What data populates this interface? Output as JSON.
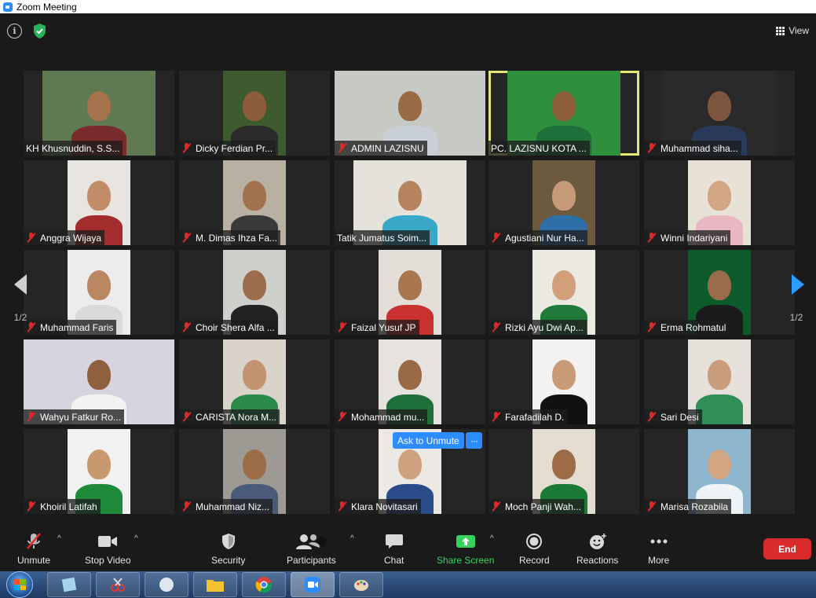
{
  "window": {
    "title": "Zoom Meeting"
  },
  "header": {
    "view_label": "View"
  },
  "pager": {
    "left_page": "1/2",
    "right_page": "1/2"
  },
  "participants": [
    {
      "name": "KH Khusnuddin, S.S...",
      "muted": false,
      "bg": "#5f7a52",
      "skin": "#a6724d",
      "shirt": "#7a2c2c",
      "vw": 144
    },
    {
      "name": "Dicky Ferdian Pr...",
      "muted": true,
      "bg": "#3e5a2f",
      "skin": "#8c5d3c",
      "shirt": "#2b2b2b",
      "vw": 80
    },
    {
      "name": "ADMIN LAZISNU",
      "muted": true,
      "bg": "#c7c9c4",
      "skin": "#9a6a45",
      "shirt": "#c9cfd6",
      "vw": 192
    },
    {
      "name": "PC. LAZISNU KOTA ...",
      "muted": false,
      "bg": "#2f8f3e",
      "skin": "#8e5d3a",
      "shirt": "#1f6f38",
      "vw": 144,
      "active": true
    },
    {
      "name": "Muhammad siha...",
      "muted": true,
      "bg": "#2a2a2a",
      "skin": "#7e563d",
      "shirt": "#2a3a5a",
      "vw": 144
    },
    {
      "name": "Anggra Wijaya",
      "muted": true,
      "bg": "#e8e4df",
      "skin": "#c18d68",
      "shirt": "#a32c2c",
      "vw": 80
    },
    {
      "name": "M. Dimas Ihza Fa...",
      "muted": true,
      "bg": "#b8b0a0",
      "skin": "#a2714e",
      "shirt": "#3a3a3a",
      "vw": 80
    },
    {
      "name": "Tatik Jumatus Soim...",
      "muted": false,
      "bg": "#e5e2dc",
      "skin": "#b78460",
      "shirt": "#39a8c8",
      "vw": 144
    },
    {
      "name": "Agustiani Nur Ha...",
      "muted": true,
      "bg": "#6b5a3e",
      "skin": "#c59a78",
      "shirt": "#2f6fa8",
      "vw": 80
    },
    {
      "name": "Winni Indariyani",
      "muted": true,
      "bg": "#e8e2d6",
      "skin": "#d2a585",
      "shirt": "#e8b7c2",
      "vw": 80
    },
    {
      "name": "Muhammad Faris",
      "muted": true,
      "bg": "#ececec",
      "skin": "#b98762",
      "shirt": "#d9d9d9",
      "vw": 80
    },
    {
      "name": "Choir Shera Alfa ...",
      "muted": true,
      "bg": "#cfd0cb",
      "skin": "#9c6d4c",
      "shirt": "#222222",
      "vw": 80
    },
    {
      "name": "Faizal Yusuf JP",
      "muted": true,
      "bg": "#e3dfd8",
      "skin": "#a8764f",
      "shirt": "#c93030",
      "vw": 80
    },
    {
      "name": "Rizki Ayu Dwi Ap...",
      "muted": true,
      "bg": "#ece8e2",
      "skin": "#d1a07b",
      "shirt": "#1f7a3a",
      "vw": 80
    },
    {
      "name": "Erma Rohmatul",
      "muted": true,
      "bg": "#0d5a2a",
      "skin": "#9a6b4d",
      "shirt": "#1b1b1b",
      "vw": 80
    },
    {
      "name": "Wahyu Fatkur Ro...",
      "muted": true,
      "bg": "#d7d3df",
      "skin": "#8f603f",
      "shirt": "#f2f2f2",
      "vw": 192
    },
    {
      "name": "CARISTA Nora M...",
      "muted": true,
      "bg": "#d9d3c9",
      "skin": "#c39371",
      "shirt": "#2b8a4a",
      "vw": 80
    },
    {
      "name": "Mohammad mu...",
      "muted": true,
      "bg": "#e6e3de",
      "skin": "#9a6a46",
      "shirt": "#1f6f3a",
      "vw": 80
    },
    {
      "name": "Farafadilah D.",
      "muted": true,
      "bg": "#f2f2f2",
      "skin": "#c79a78",
      "shirt": "#111111",
      "vw": 80
    },
    {
      "name": "Sari Desi",
      "muted": true,
      "bg": "#e5e0da",
      "skin": "#c99d7c",
      "shirt": "#2f8f56",
      "vw": 80
    },
    {
      "name": "Khoiril Latifah",
      "muted": true,
      "bg": "#f1f1f1",
      "skin": "#c8996f",
      "shirt": "#1f8a3a",
      "vw": 80
    },
    {
      "name": "Muhammad Niz...",
      "muted": true,
      "bg": "#9d9a93",
      "skin": "#9c6c47",
      "shirt": "#4a5a7a",
      "vw": 80
    },
    {
      "name": "Klara Novitasari",
      "muted": true,
      "bg": "#ece9e4",
      "skin": "#cfa27f",
      "shirt": "#2a4d8a",
      "vw": 80
    },
    {
      "name": "Moch Panji Wah...",
      "muted": true,
      "bg": "#e4ddd2",
      "skin": "#9d6b47",
      "shirt": "#1b7a34",
      "vw": 80
    },
    {
      "name": "Marisa Rozabila",
      "muted": true,
      "bg": "#8eb7cf",
      "skin": "#d2a682",
      "shirt": "#eef3f6",
      "vw": 80
    }
  ],
  "ask_unmute": {
    "label": "Ask to Unmute",
    "more": "···"
  },
  "toolbar": {
    "unmute": "Unmute",
    "stop_video": "Stop Video",
    "security": "Security",
    "participants": "Participants",
    "chat": "Chat",
    "share_screen": "Share Screen",
    "record": "Record",
    "reactions": "Reactions",
    "more": "More",
    "end": "End"
  },
  "colors": {
    "accent": "#2d8cff",
    "active_border": "#e4e873",
    "end": "#d92b2b",
    "share": "#35d35b",
    "muted": "#e02828"
  }
}
